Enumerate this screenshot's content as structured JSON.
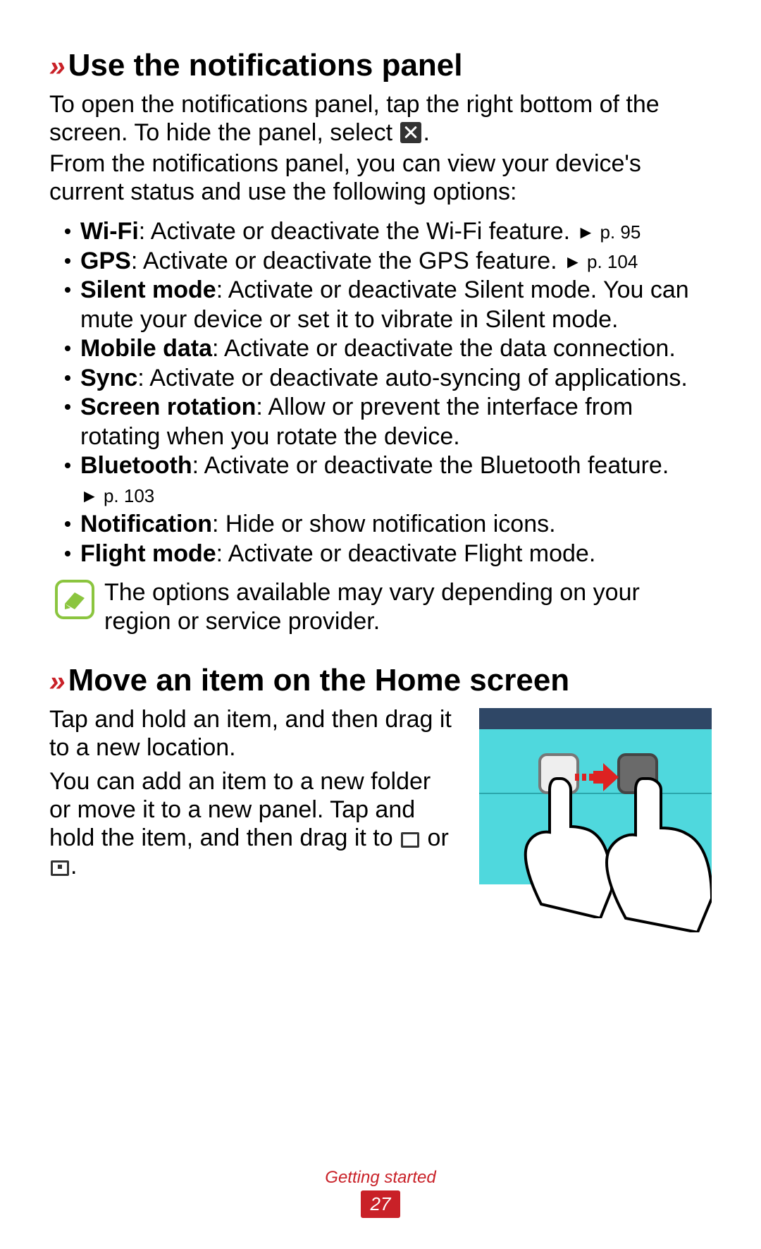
{
  "section1": {
    "title": "Use the notifications panel",
    "para1_a": "To open the notifications panel, tap the right bottom of the screen. To hide the panel, select ",
    "para1_b": ".",
    "para2": "From the notifications panel, you can view your device's current status and use the following options:",
    "bullets": [
      {
        "label": "Wi-Fi",
        "text": ": Activate or deactivate the Wi-Fi feature. ",
        "ref": "► p. 95"
      },
      {
        "label": "GPS",
        "text": ": Activate or deactivate the GPS feature. ",
        "ref": "► p. 104"
      },
      {
        "label": "Silent mode",
        "text": ": Activate or deactivate Silent mode. You can mute your device or set it to vibrate in Silent mode.",
        "ref": ""
      },
      {
        "label": "Mobile data",
        "text": ": Activate or deactivate the data connection.",
        "ref": ""
      },
      {
        "label": "Sync",
        "text": ": Activate or deactivate auto-syncing of applications.",
        "ref": ""
      },
      {
        "label": "Screen rotation",
        "text": ": Allow or prevent the interface from rotating when you rotate the device.",
        "ref": ""
      },
      {
        "label": "Bluetooth",
        "text": ": Activate or deactivate the Bluetooth feature. ",
        "ref": "► p. 103"
      },
      {
        "label": "Notification",
        "text": ": Hide or show notification icons.",
        "ref": ""
      },
      {
        "label": "Flight mode",
        "text": ": Activate or deactivate Flight mode.",
        "ref": ""
      }
    ],
    "note": "The options available may vary depending on your region or service provider."
  },
  "section2": {
    "title": "Move an item on the Home screen",
    "para1": "Tap and hold an item, and then drag it to a new location.",
    "para2_a": "You can add an item to a new folder or move it to a new panel. Tap and hold the item, and then drag it to ",
    "para2_b": " or ",
    "para2_c": "."
  },
  "footer": {
    "section": "Getting started",
    "page": "27"
  }
}
